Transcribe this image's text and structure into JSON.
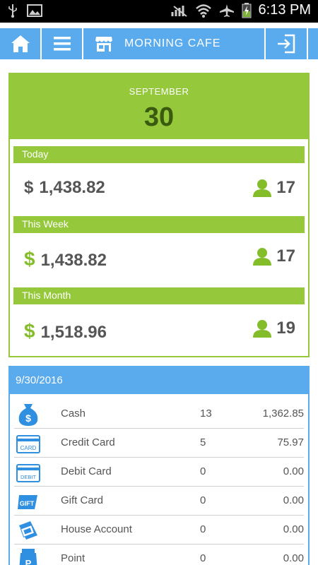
{
  "status_bar": {
    "time": "6:13 PM"
  },
  "header": {
    "title": "MORNING CAFE"
  },
  "summary": {
    "month": "SEPTEMBER",
    "day": "30",
    "periods": [
      {
        "label": "Today",
        "currency": "$",
        "amount": "1,438.82",
        "customers": "17"
      },
      {
        "label": "This Week",
        "currency": "$",
        "amount": "1,438.82",
        "customers": "17"
      },
      {
        "label": "This Month",
        "currency": "$",
        "amount": "1,518.96",
        "customers": "19"
      }
    ]
  },
  "payments": {
    "date": "9/30/2016",
    "rows": [
      {
        "name": "Cash",
        "count": "13",
        "amount": "1,362.85",
        "icon": "money-bag-icon"
      },
      {
        "name": "Credit Card",
        "count": "5",
        "amount": "75.97",
        "icon": "credit-card-icon"
      },
      {
        "name": "Debit Card",
        "count": "0",
        "amount": "0.00",
        "icon": "debit-card-icon"
      },
      {
        "name": "Gift Card",
        "count": "0",
        "amount": "0.00",
        "icon": "gift-card-icon"
      },
      {
        "name": "House Account",
        "count": "0",
        "amount": "0.00",
        "icon": "house-account-icon"
      },
      {
        "name": "Point",
        "count": "0",
        "amount": "0.00",
        "icon": "point-icon"
      }
    ],
    "icon_text": {
      "card": "CARD",
      "debit": "DEBIT",
      "gift": "GIFT",
      "point": "P",
      "cash": "$"
    }
  },
  "colors": {
    "accent_green": "#95c83b",
    "accent_blue": "#5aaaee"
  }
}
